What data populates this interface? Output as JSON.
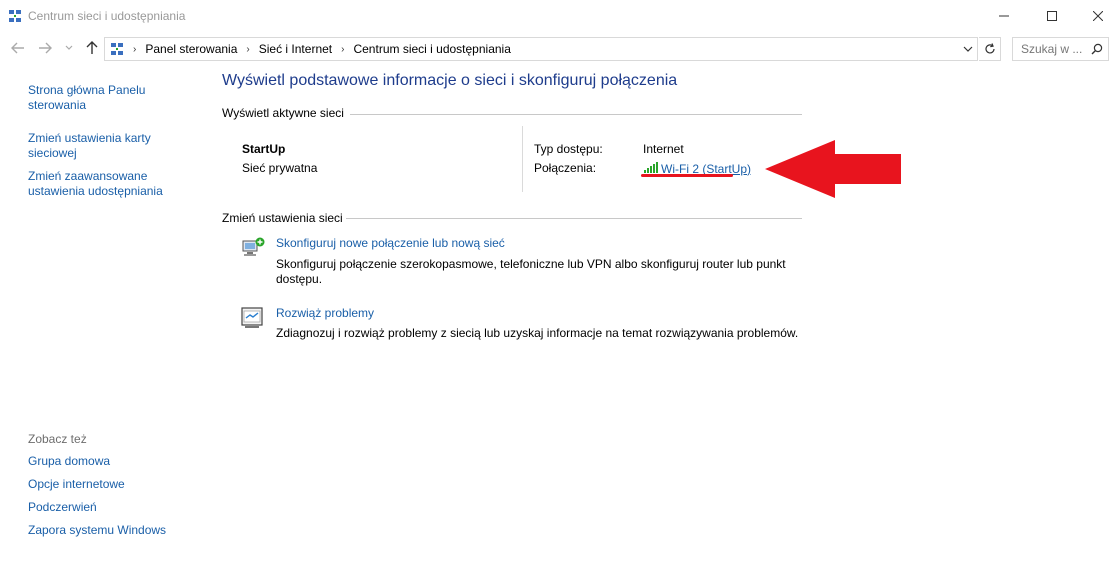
{
  "window": {
    "title": "Centrum sieci i udostępniania"
  },
  "address": {
    "crumbs": [
      "Panel sterowania",
      "Sieć i Internet",
      "Centrum sieci i udostępniania"
    ],
    "search_placeholder": "Szukaj w ..."
  },
  "sidebar": {
    "links": [
      "Strona główna Panelu sterowania",
      "Zmień ustawienia karty sieciowej",
      "Zmień zaawansowane ustawienia udostępniania"
    ],
    "see_also_title": "Zobacz też",
    "see_also": [
      "Grupa domowa",
      "Opcje internetowe",
      "Podczerwień",
      "Zapora systemu Windows"
    ]
  },
  "main": {
    "title": "Wyświetl podstawowe informacje o sieci i skonfiguruj połączenia",
    "active_networks_heading": "Wyświetl aktywne sieci",
    "network": {
      "name": "StartUp",
      "category": "Sieć prywatna",
      "access_type_label": "Typ dostępu:",
      "access_type_value": "Internet",
      "connections_label": "Połączenia:",
      "connection_link": "Wi-Fi 2 (StartUp)"
    },
    "change_settings_heading": "Zmień ustawienia sieci",
    "tasks": [
      {
        "link": "Skonfiguruj nowe połączenie lub nową sieć",
        "desc_line1": "Skonfiguruj połączenie szerokopasmowe, telefoniczne lub VPN albo skonfiguruj router lub punkt",
        "desc_line2": "dostępu."
      },
      {
        "link": "Rozwiąż problemy",
        "desc_line1": "Zdiagnozuj i rozwiąż problemy z siecią lub uzyskaj informacje na temat rozwiązywania problemów."
      }
    ]
  },
  "colors": {
    "link": "#1a5fa8",
    "title": "#1e3c8c",
    "annotation": "#e8141e",
    "wifi_bars": "#2aa52a"
  }
}
